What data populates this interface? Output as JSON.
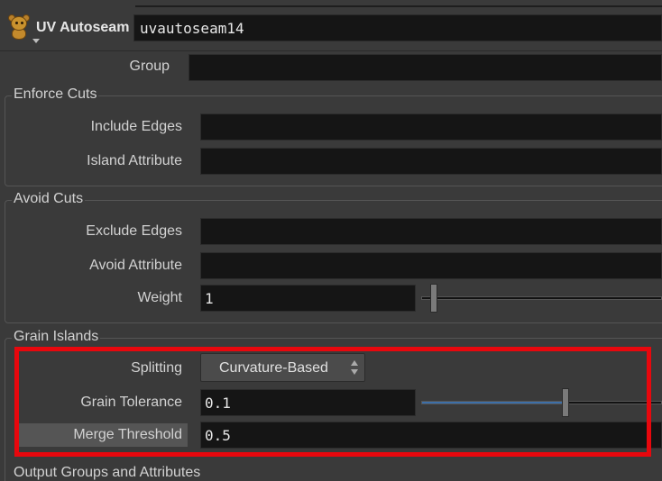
{
  "node": {
    "type_label": "UV Autoseam",
    "name": "uvautoseam14",
    "icon": "teddy-bear-icon"
  },
  "group": {
    "label": "Group",
    "value": ""
  },
  "enforce_cuts": {
    "title": "Enforce Cuts",
    "include_edges": {
      "label": "Include Edges",
      "value": ""
    },
    "island_attribute": {
      "label": "Island Attribute",
      "value": ""
    }
  },
  "avoid_cuts": {
    "title": "Avoid Cuts",
    "exclude_edges": {
      "label": "Exclude Edges",
      "value": ""
    },
    "avoid_attribute": {
      "label": "Avoid Attribute",
      "value": ""
    },
    "weight": {
      "label": "Weight",
      "value": "1",
      "slider_fraction": 0.0
    }
  },
  "grain_islands": {
    "title": "Grain Islands",
    "splitting": {
      "label": "Splitting",
      "value": "Curvature-Based"
    },
    "grain_tolerance": {
      "label": "Grain Tolerance",
      "value": "0.1",
      "slider_fraction": 0.6
    },
    "merge_threshold": {
      "label": "Merge Threshold",
      "value": "0.5"
    }
  },
  "output_groups": {
    "title": "Output Groups and Attributes"
  },
  "colors": {
    "background": "#3a3a3a",
    "field": "#151515",
    "highlight": "#e8070d",
    "slider_fill": "#3d6fa8"
  }
}
